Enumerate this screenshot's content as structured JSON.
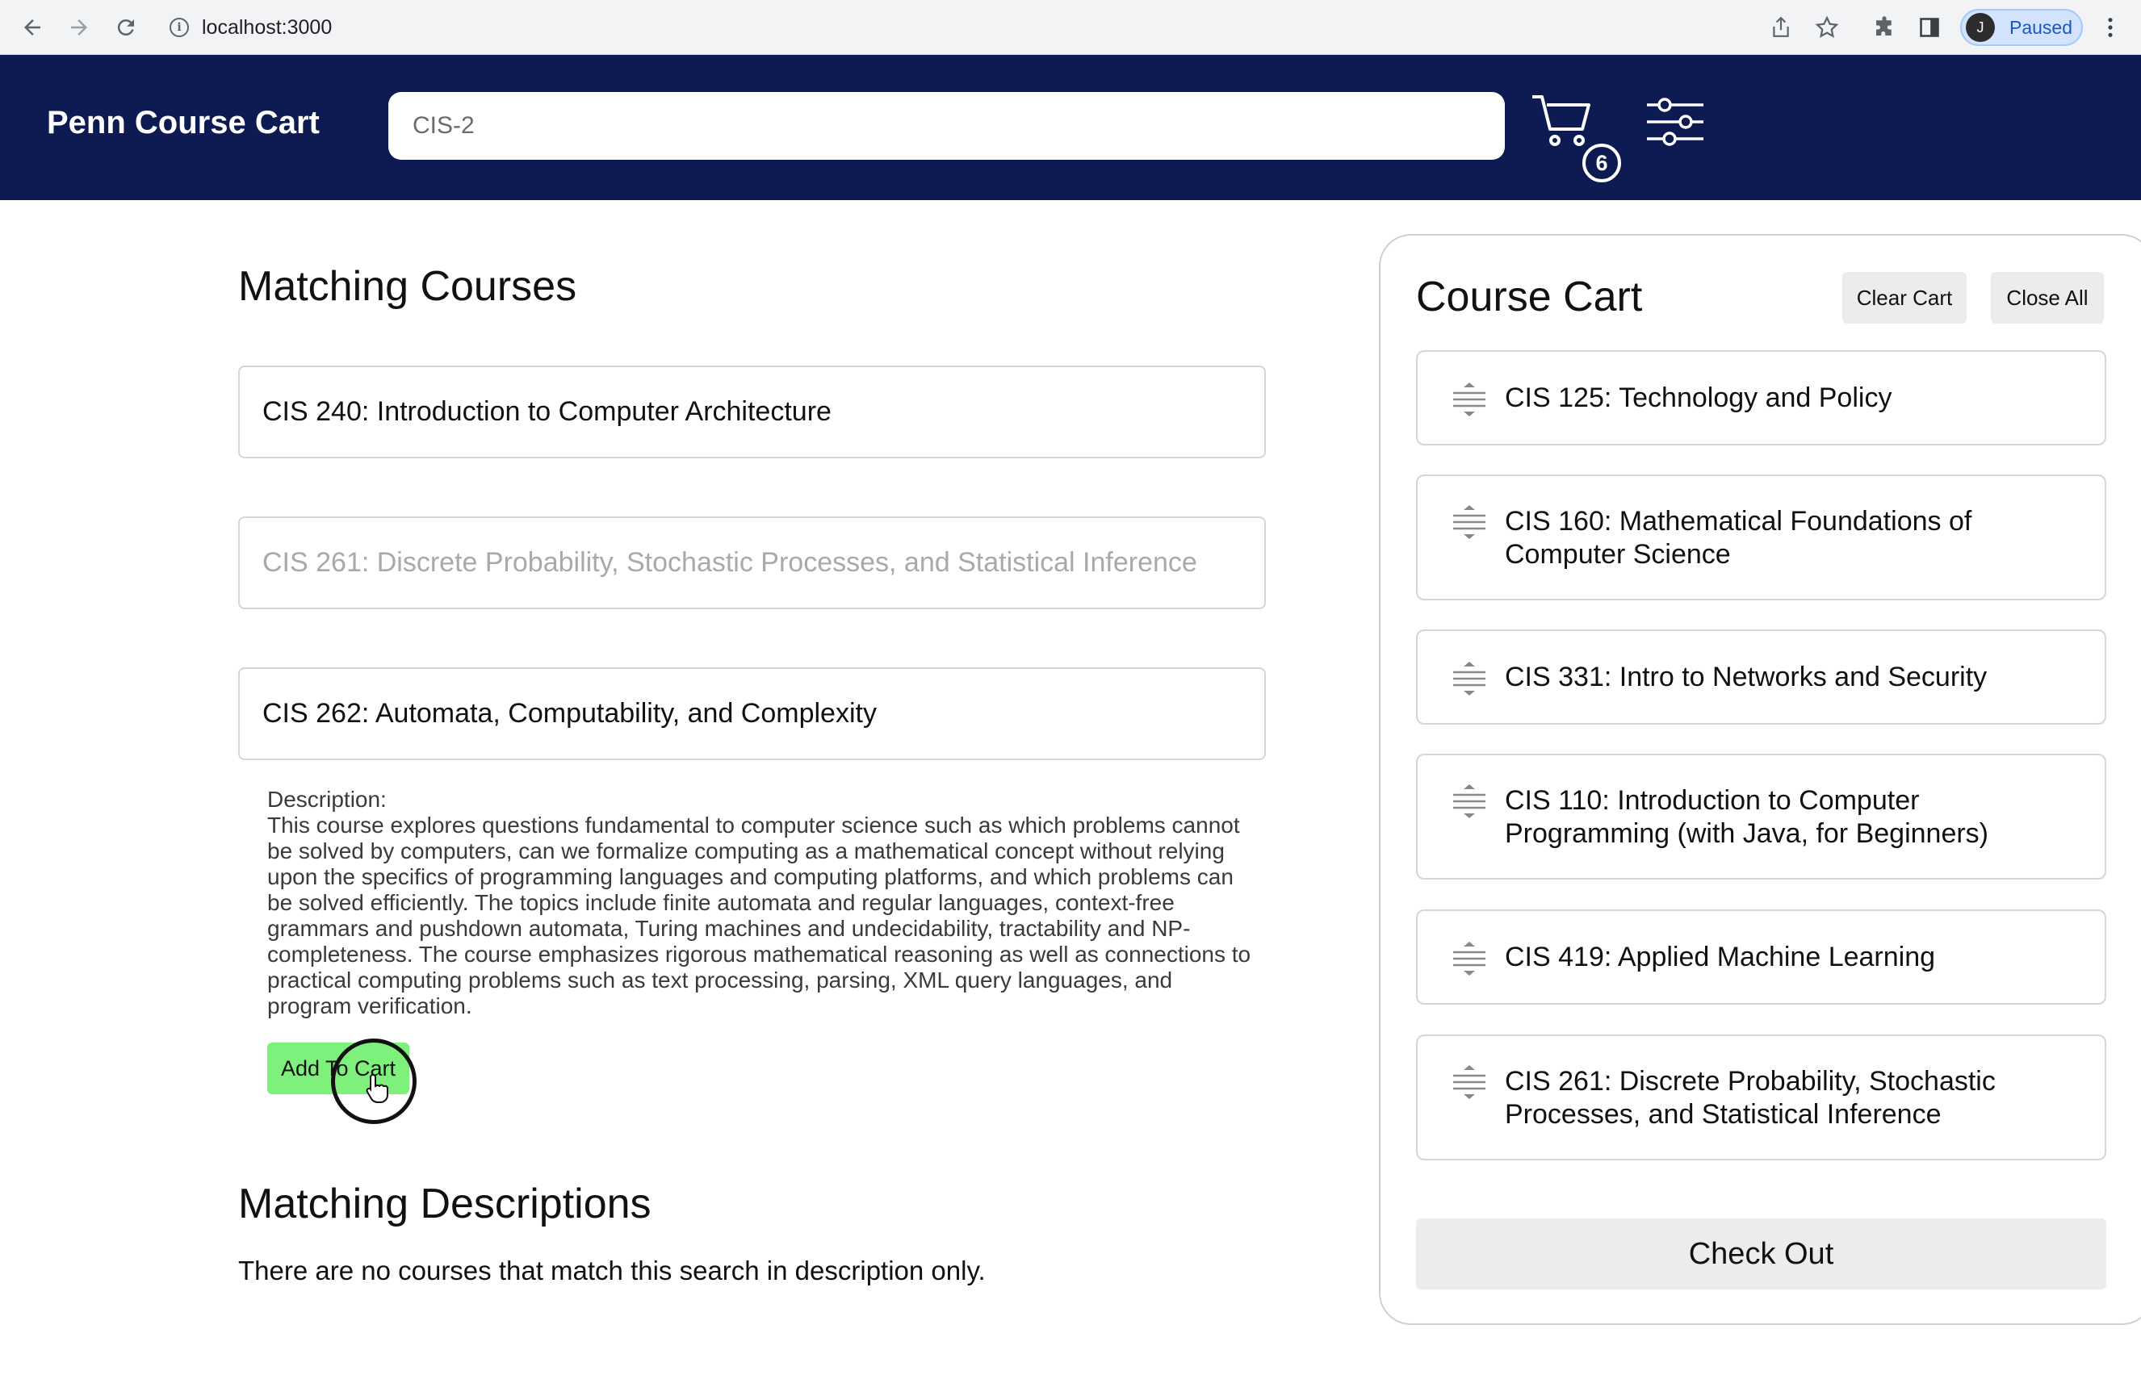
{
  "browser": {
    "url": "localhost:3000",
    "profile_initial": "J",
    "profile_status": "Paused"
  },
  "header": {
    "brand": "Penn Course Cart",
    "search_value": "CIS-2",
    "cart_count": "6"
  },
  "matching_courses": {
    "title": "Matching Courses",
    "items": [
      {
        "label": "CIS 240: Introduction to Computer Architecture",
        "state": "normal"
      },
      {
        "label": "CIS 261: Discrete Probability, Stochastic Processes, and Statistical Inference",
        "state": "faded"
      },
      {
        "label": "CIS 262: Automata, Computability, and Complexity",
        "state": "expanded"
      }
    ],
    "description_label": "Description:",
    "description_text": "This course explores questions fundamental to computer science such as which problems cannot be solved by computers, can we formalize computing as a mathematical concept without relying upon the specifics of programming languages and computing platforms, and which problems can be solved efficiently. The topics include finite automata and regular languages, context-free grammars and pushdown automata, Turing machines and undecidability, tractability and NP-completeness. The course emphasizes rigorous mathematical reasoning as well as connections to practical computing problems such as text processing, parsing, XML query languages, and program verification.",
    "add_button": "Add To Cart"
  },
  "matching_descriptions": {
    "title": "Matching Descriptions",
    "empty_text": "There are no courses that match this search in description only."
  },
  "cart": {
    "title": "Course Cart",
    "clear_button": "Clear Cart",
    "close_all_button": "Close All",
    "items": [
      {
        "label": "CIS 125: Technology and Policy"
      },
      {
        "label": "CIS 160: Mathematical Foundations of Computer Science"
      },
      {
        "label": "CIS 331: Intro to Networks and Security"
      },
      {
        "label": "CIS 110: Introduction to Computer Programming (with Java, for Beginners)"
      },
      {
        "label": "CIS 419: Applied Machine Learning"
      },
      {
        "label": "CIS 261: Discrete Probability, Stochastic Processes, and Statistical Inference"
      }
    ],
    "checkout_button": "Check Out"
  },
  "colors": {
    "header_bg": "#0d1b52",
    "add_button_bg": "#7ef07c",
    "neutral_button_bg": "#ececec"
  },
  "icons": [
    "back-arrow-icon",
    "forward-arrow-icon",
    "reload-icon",
    "info-icon",
    "share-icon",
    "bookmark-star-icon",
    "extensions-icon",
    "side-panel-icon",
    "menu-dots-icon",
    "cart-icon",
    "filter-sliders-icon",
    "drag-handle-icon",
    "pointer-cursor-icon"
  ]
}
